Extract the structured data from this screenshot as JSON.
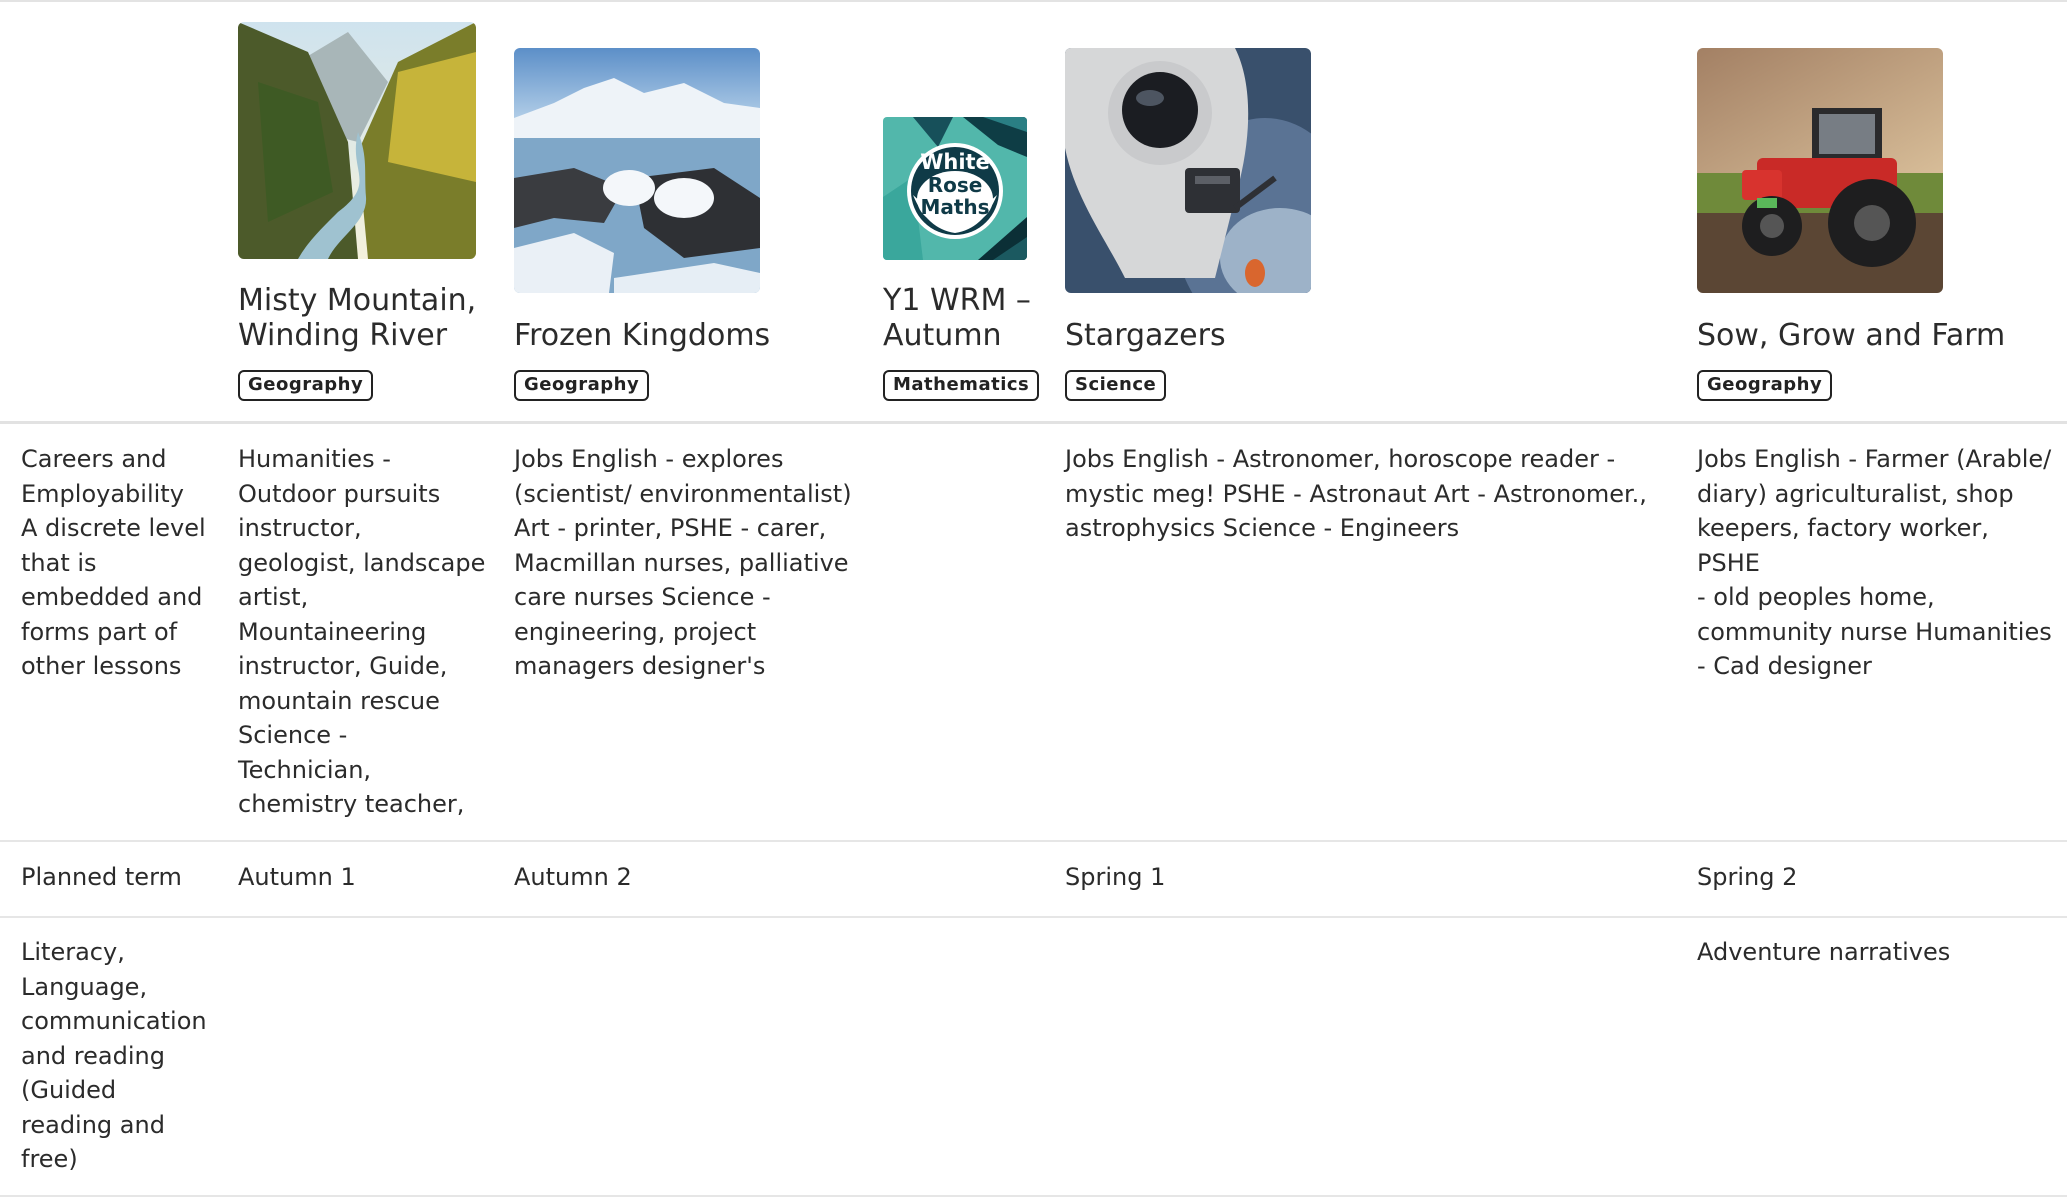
{
  "columns": [
    {
      "title_l1": "Misty Mountain,",
      "title_l2": "Winding River",
      "badge": "Geography",
      "image": "mountain-valley-river"
    },
    {
      "title_l1": "",
      "title_l2": "Frozen Kingdoms",
      "badge": "Geography",
      "image": "arctic-ice"
    },
    {
      "title_l1": "Y1 WRM –",
      "title_l2": "Autumn",
      "badge": "Mathematics",
      "image": "white-rose-maths-logo",
      "logo_l1": "White",
      "logo_l2": "Rose",
      "logo_l3": "Maths"
    },
    {
      "title_l1": "",
      "title_l2": "Stargazers",
      "badge": "Science",
      "image": "astronaut"
    },
    {
      "title_l1": "",
      "title_l2": "Sow, Grow and Farm",
      "badge": "Geography",
      "image": "red-tractor"
    }
  ],
  "rows": {
    "careers": {
      "label": [
        "Careers and",
        "Employability",
        "A discrete level",
        "that is",
        "embedded and",
        "forms part of",
        "other lessons"
      ],
      "cells": [
        [
          "Humanities -",
          "Outdoor pursuits",
          "instructor,",
          "geologist, landscape",
          "artist,",
          "Mountaineering",
          "instructor, Guide,",
          "mountain rescue",
          "Science -",
          "Technician,",
          "chemistry teacher,"
        ],
        [
          "Jobs English - explores",
          "(scientist/ environmentalist)",
          "Art - printer, PSHE - carer,",
          "Macmillan nurses, palliative",
          "care nurses Science -",
          "engineering, project",
          "managers designer's"
        ],
        [],
        [
          "Jobs English - Astronomer, horoscope reader -",
          "mystic meg! PSHE - Astronaut Art - Astronomer.,",
          "astrophysics Science - Engineers"
        ],
        [
          "Jobs English - Farmer (Arable/",
          "diary) agriculturalist, shop",
          "keepers, factory worker, PSHE",
          "- old peoples home,",
          "community nurse Humanities",
          "- Cad designer"
        ]
      ]
    },
    "term": {
      "label": "Planned term",
      "cells": [
        "Autumn 1",
        "Autumn 2",
        "",
        "Spring 1",
        "Spring 2"
      ]
    },
    "literacy": {
      "label": [
        "Literacy,",
        "Language,",
        "communication",
        "and reading",
        "(Guided",
        "reading and",
        "free)"
      ],
      "cells": [
        "",
        "",
        "",
        "",
        "Adventure narratives"
      ]
    }
  }
}
